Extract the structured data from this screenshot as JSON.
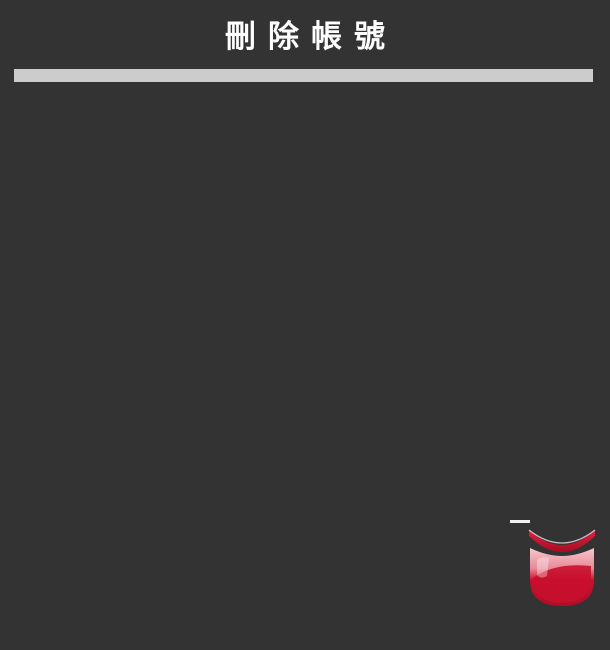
{
  "header": {
    "title": "刪除帳號"
  },
  "colors": {
    "background": "#333333",
    "bar": "#cccccc",
    "title_text": "#ffffff",
    "widget_red": "#c8102e",
    "widget_pink": "#f2b8c0"
  },
  "icons": {
    "minimize": "minimize-dash-icon",
    "widget": "red-cup-icon"
  }
}
